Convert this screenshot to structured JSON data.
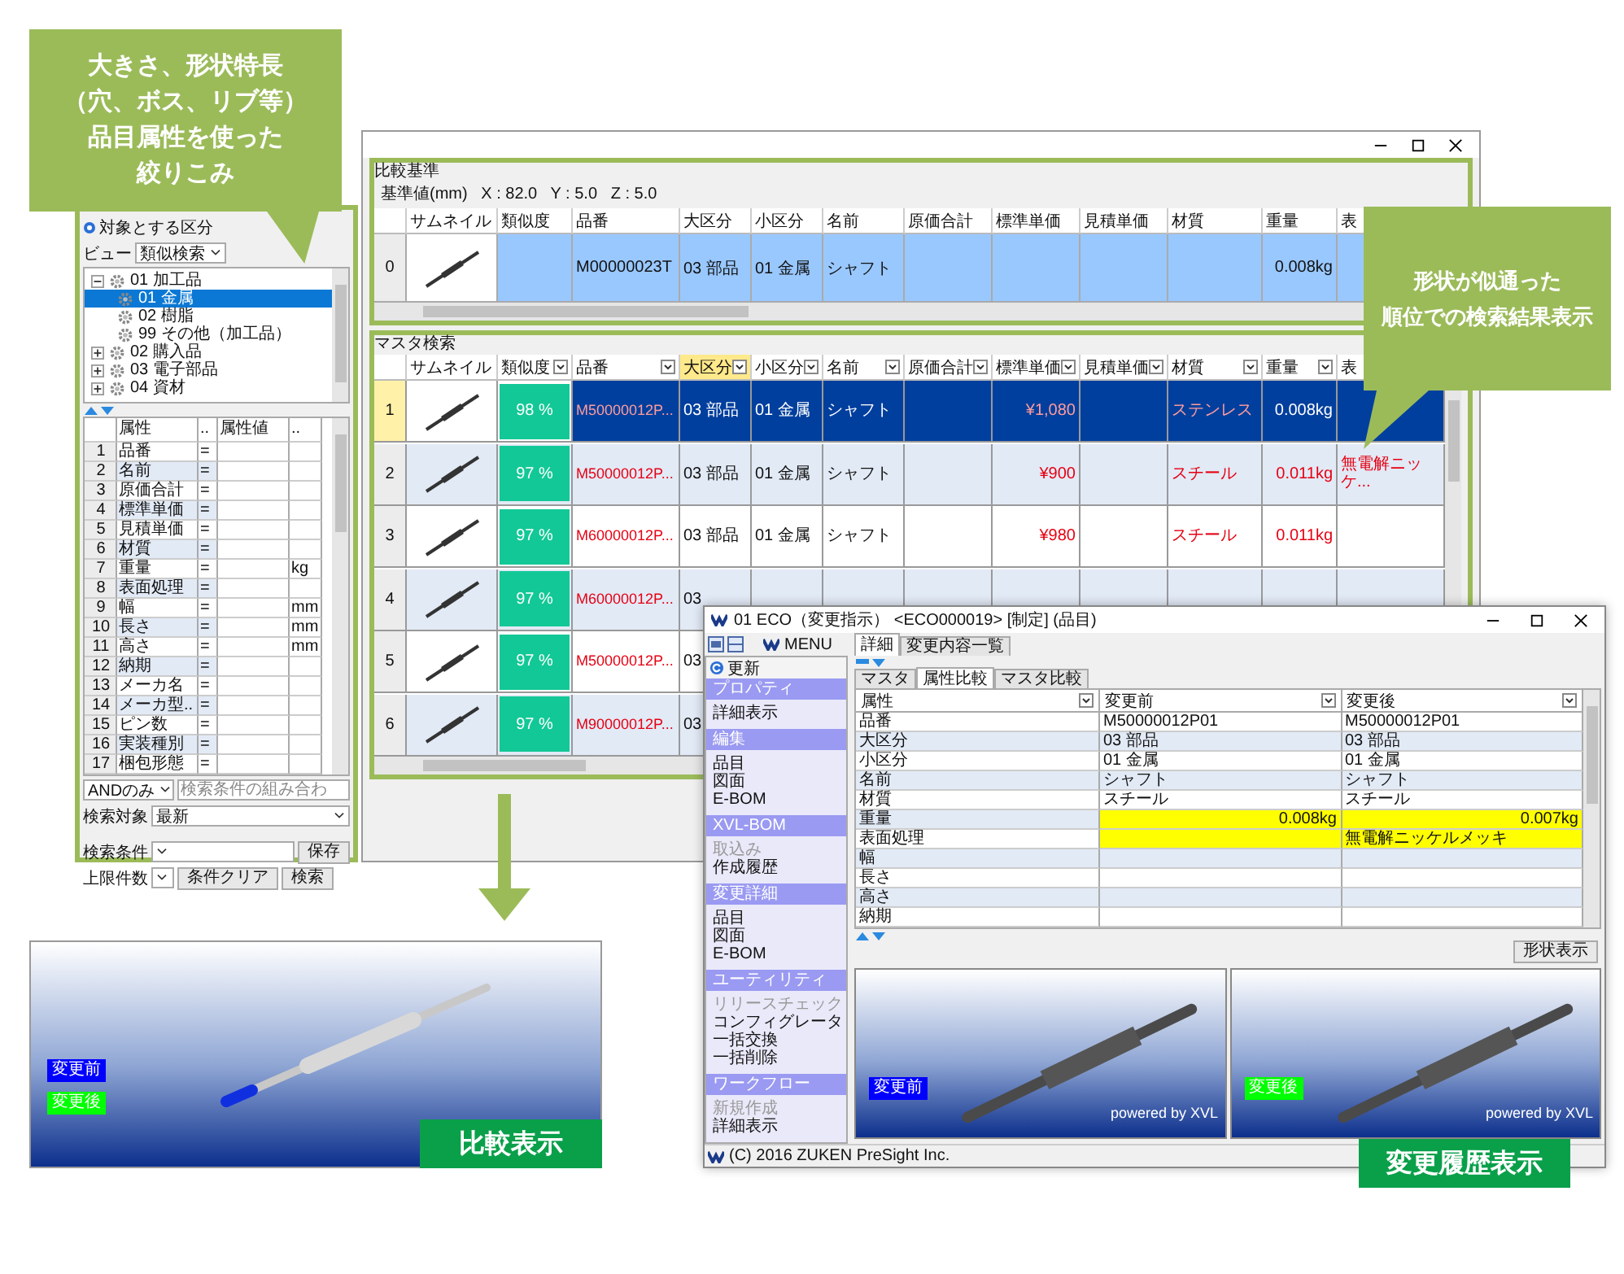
{
  "filter_callout": {
    "lines": [
      "大きさ、形状特長",
      "（穴、ボス、リブ等）",
      "品目属性を使った",
      "絞りこみ"
    ]
  },
  "search_panel": {
    "target_label": "対象とする区分",
    "view_label": "ビュー",
    "view_value": "類似検索",
    "tree": [
      {
        "label": "01 加工品",
        "expanded": true,
        "selected": false,
        "children": [
          {
            "label": "01 金属",
            "selected": true
          },
          {
            "label": "02 樹脂",
            "selected": false
          },
          {
            "label": "99 その他（加工品）",
            "selected": false
          }
        ]
      },
      {
        "label": "02 購入品",
        "expanded": false,
        "selected": false
      },
      {
        "label": "03 電子部品",
        "expanded": false,
        "selected": false
      },
      {
        "label": "04 資材",
        "expanded": false,
        "selected": false
      }
    ],
    "grid_columns": [
      "属性",
      "..",
      "属性値",
      ".."
    ],
    "grid_rows": [
      {
        "no": "1",
        "name": "品番",
        "op": "="
      },
      {
        "no": "2",
        "name": "名前",
        "op": "="
      },
      {
        "no": "3",
        "name": "原価合計",
        "op": "="
      },
      {
        "no": "4",
        "name": "標準単価",
        "op": "="
      },
      {
        "no": "5",
        "name": "見積単価",
        "op": "="
      },
      {
        "no": "6",
        "name": "材質",
        "op": "="
      },
      {
        "no": "7",
        "name": "重量",
        "op": "=",
        "unit": "kg"
      },
      {
        "no": "8",
        "name": "表面処理",
        "op": "="
      },
      {
        "no": "9",
        "name": "幅",
        "op": "=",
        "unit": "mm"
      },
      {
        "no": "10",
        "name": "長さ",
        "op": "=",
        "unit": "mm"
      },
      {
        "no": "11",
        "name": "高さ",
        "op": "=",
        "unit": "mm"
      },
      {
        "no": "12",
        "name": "納期",
        "op": "="
      },
      {
        "no": "13",
        "name": "メーカ名",
        "op": "="
      },
      {
        "no": "14",
        "name": "メーカ型..",
        "op": "="
      },
      {
        "no": "15",
        "name": "ピン数",
        "op": "="
      },
      {
        "no": "16",
        "name": "実装種別",
        "op": "="
      },
      {
        "no": "17",
        "name": "梱包形態",
        "op": "="
      }
    ],
    "and_mode": "ANDのみ",
    "combo_placeholder": "検索条件の組み合わ",
    "search_target_label": "検索対象",
    "search_target_value": "最新",
    "condition_label": "検索条件",
    "save_button": "保存",
    "limit_label": "上限件数",
    "clear_button": "条件クリア",
    "search_button": "検索"
  },
  "main_window": {
    "reference": {
      "title": "比較基準",
      "basis": "基準値(mm)   X : 82.0   Y : 5.0   Z : 5.0",
      "columns": [
        "サムネイル",
        "類似度",
        "品番",
        "大区分",
        "小区分",
        "名前",
        "原価合計",
        "標準単価",
        "見積単価",
        "材質",
        "重量",
        "表"
      ],
      "rows": [
        {
          "no": "0",
          "cells": [
            null,
            null,
            "M00000023T",
            "03 部品",
            "01 金属",
            "シャフト",
            null,
            null,
            null,
            null,
            "0.008kg",
            null
          ]
        }
      ]
    },
    "master": {
      "title": "マスタ検索",
      "columns": [
        {
          "label": "サムネイル",
          "filter": false,
          "selected": false
        },
        {
          "label": "類似度",
          "filter": true,
          "selected": false
        },
        {
          "label": "品番",
          "filter": true,
          "selected": false
        },
        {
          "label": "大区分",
          "filter": true,
          "selected": true
        },
        {
          "label": "小区分",
          "filter": true,
          "selected": false
        },
        {
          "label": "名前",
          "filter": true,
          "selected": false
        },
        {
          "label": "原価合計",
          "filter": true,
          "selected": false
        },
        {
          "label": "標準単価",
          "filter": true,
          "selected": false
        },
        {
          "label": "見積単価",
          "filter": true,
          "selected": false
        },
        {
          "label": "材質",
          "filter": true,
          "selected": false
        },
        {
          "label": "重量",
          "filter": true,
          "selected": false
        },
        {
          "label": "表",
          "filter": false,
          "selected": false
        }
      ],
      "rows": [
        {
          "no": "1",
          "selected": true,
          "cells": [
            null,
            {
              "text": "98 %",
              "changed": false
            },
            {
              "text": "M50000012P...",
              "changed": true
            },
            {
              "text": "03 部品",
              "changed": false
            },
            {
              "text": "01 金属",
              "changed": false
            },
            {
              "text": "シャフト",
              "changed": false
            },
            null,
            {
              "text": "¥1,080",
              "changed": true
            },
            null,
            {
              "text": "ステンレス",
              "changed": true
            },
            {
              "text": "0.008kg",
              "changed": false
            },
            null
          ]
        },
        {
          "no": "2",
          "selected": false,
          "cells": [
            null,
            {
              "text": "97 %",
              "changed": false
            },
            {
              "text": "M50000012P...",
              "changed": true
            },
            {
              "text": "03 部品",
              "changed": false
            },
            {
              "text": "01 金属",
              "changed": false
            },
            {
              "text": "シャフト",
              "changed": false
            },
            null,
            {
              "text": "¥900",
              "changed": true
            },
            null,
            {
              "text": "スチール",
              "changed": true
            },
            {
              "text": "0.011kg",
              "changed": true
            },
            {
              "text": "無電解ニッケ...",
              "changed": true
            }
          ]
        },
        {
          "no": "3",
          "selected": false,
          "cells": [
            null,
            {
              "text": "97 %",
              "changed": false
            },
            {
              "text": "M60000012P...",
              "changed": true
            },
            {
              "text": "03 部品",
              "changed": false
            },
            {
              "text": "01 金属",
              "changed": false
            },
            {
              "text": "シャフト",
              "changed": false
            },
            null,
            {
              "text": "¥980",
              "changed": true
            },
            null,
            {
              "text": "スチール",
              "changed": true
            },
            {
              "text": "0.011kg",
              "changed": true
            },
            null
          ]
        },
        {
          "no": "4",
          "selected": false,
          "cells": [
            null,
            {
              "text": "97 %",
              "changed": false
            },
            {
              "text": "M60000012P...",
              "changed": true
            },
            {
              "text": "03",
              "changed": false
            }
          ]
        },
        {
          "no": "5",
          "selected": false,
          "cells": [
            null,
            {
              "text": "97 %",
              "changed": false
            },
            {
              "text": "M50000012P...",
              "changed": true
            },
            {
              "text": "03",
              "changed": false
            }
          ]
        },
        {
          "no": "6",
          "selected": false,
          "cells": [
            null,
            {
              "text": "97 %",
              "changed": false
            },
            {
              "text": "M90000012P...",
              "changed": true
            },
            {
              "text": "03",
              "changed": false
            }
          ]
        }
      ]
    }
  },
  "result_callout": {
    "lines": [
      "形状が似通った",
      "順位での検索結果表示"
    ]
  },
  "compare_viewer": {
    "labels": [
      {
        "text": "変更前",
        "color": "#0000ff"
      },
      {
        "text": "変更後",
        "color": "#00ff00"
      }
    ],
    "badge": "比較表示"
  },
  "eco_window": {
    "title": "01 ECO（変更指示）  <ECO000019> [制定] (品目)",
    "menu": "MENU",
    "refresh": "更新",
    "sidebar": [
      {
        "title": "プロパティ",
        "items": [
          {
            "label": "詳細表示",
            "disabled": false
          }
        ]
      },
      {
        "title": "編集",
        "items": [
          {
            "label": "品目",
            "disabled": false
          },
          {
            "label": "図面",
            "disabled": false
          },
          {
            "label": "E-BOM",
            "disabled": false
          }
        ]
      },
      {
        "title": "XVL-BOM",
        "items": [
          {
            "label": "取込み",
            "disabled": true
          },
          {
            "label": "作成履歴",
            "disabled": false
          }
        ]
      },
      {
        "title": "変更詳細",
        "items": [
          {
            "label": "品目",
            "disabled": false
          },
          {
            "label": "図面",
            "disabled": false
          },
          {
            "label": "E-BOM",
            "disabled": false
          }
        ]
      },
      {
        "title": "ユーティリティ",
        "items": [
          {
            "label": "リリースチェック",
            "disabled": true
          },
          {
            "label": "コンフィグレータ",
            "disabled": false
          },
          {
            "label": "一括交換",
            "disabled": false
          },
          {
            "label": "一括削除",
            "disabled": false
          }
        ]
      },
      {
        "title": "ワークフロー",
        "items": [
          {
            "label": "新規作成",
            "disabled": true
          },
          {
            "label": "詳細表示",
            "disabled": false
          }
        ]
      }
    ],
    "tabs": [
      {
        "label": "詳細",
        "selected": true
      },
      {
        "label": "変更内容一覧",
        "selected": false
      }
    ],
    "subtabs": [
      {
        "label": "マスタ",
        "selected": false
      },
      {
        "label": "属性比較",
        "selected": true
      },
      {
        "label": "マスタ比較",
        "selected": false
      }
    ],
    "columns": [
      "属性",
      "変更前",
      "変更後"
    ],
    "rows": [
      {
        "name": "品番",
        "before": "M50000012P01",
        "after": "M50000012P01",
        "changed": false
      },
      {
        "name": "大区分",
        "before": "03 部品",
        "after": "03 部品",
        "changed": false
      },
      {
        "name": "小区分",
        "before": "01 金属",
        "after": "01 金属",
        "changed": false
      },
      {
        "name": "名前",
        "before": "シャフト",
        "after": "シャフト",
        "changed": false
      },
      {
        "name": "材質",
        "before": "スチール",
        "after": "スチール",
        "changed": false
      },
      {
        "name": "重量",
        "before": "0.008kg",
        "after": "0.007kg",
        "changed": true
      },
      {
        "name": "表面処理",
        "after": "無電解ニッケルメッキ",
        "changed": true
      },
      {
        "name": "幅",
        "changed": false
      },
      {
        "name": "長さ",
        "changed": false
      },
      {
        "name": "高さ",
        "changed": false
      },
      {
        "name": "納期",
        "changed": false
      }
    ],
    "shape_button": "形状表示",
    "viewers": [
      {
        "label": "変更前",
        "color": "#0000ff",
        "credit": "powered by XVL"
      },
      {
        "label": "変更後",
        "color": "#00ff00",
        "credit": "powered by XVL"
      }
    ],
    "status": "(C) 2016 ZUKEN PreSight Inc.",
    "badge": "変更履歴表示"
  }
}
